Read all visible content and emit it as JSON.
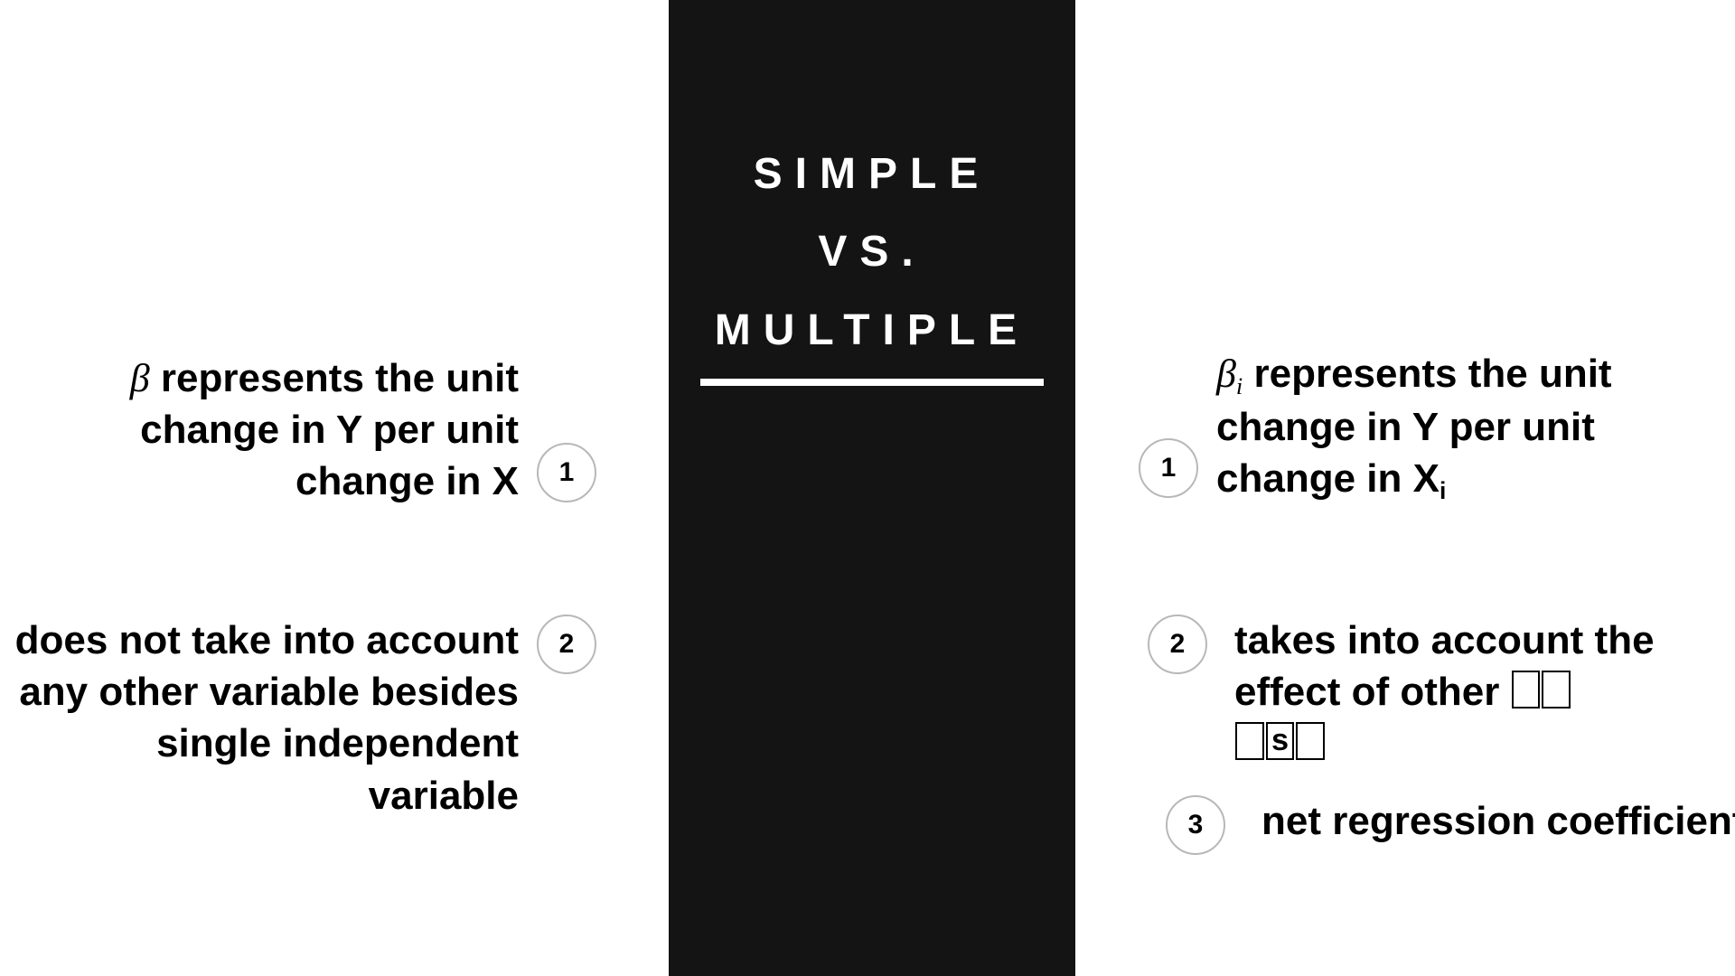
{
  "center": {
    "line1": "SIMPLE",
    "line2": "VS.",
    "line3": "MULTIPLE"
  },
  "left": {
    "items": [
      {
        "num": "1",
        "pre_symbol": "β",
        "text": " represents the unit change in Y per unit change in X"
      },
      {
        "num": "2",
        "text": "does not take into account any other variable besides single independent variable"
      }
    ]
  },
  "right": {
    "items": [
      {
        "num": "1",
        "pre_symbol": "β",
        "pre_sub": "i",
        "text": " represents the unit change in Y per unit change in X",
        "trailing_sub": "i"
      },
      {
        "num": "2",
        "text_a": "takes into account the effect of other ",
        "text_b": "s"
      },
      {
        "num": "3",
        "text": "net regression coefficient"
      }
    ]
  }
}
